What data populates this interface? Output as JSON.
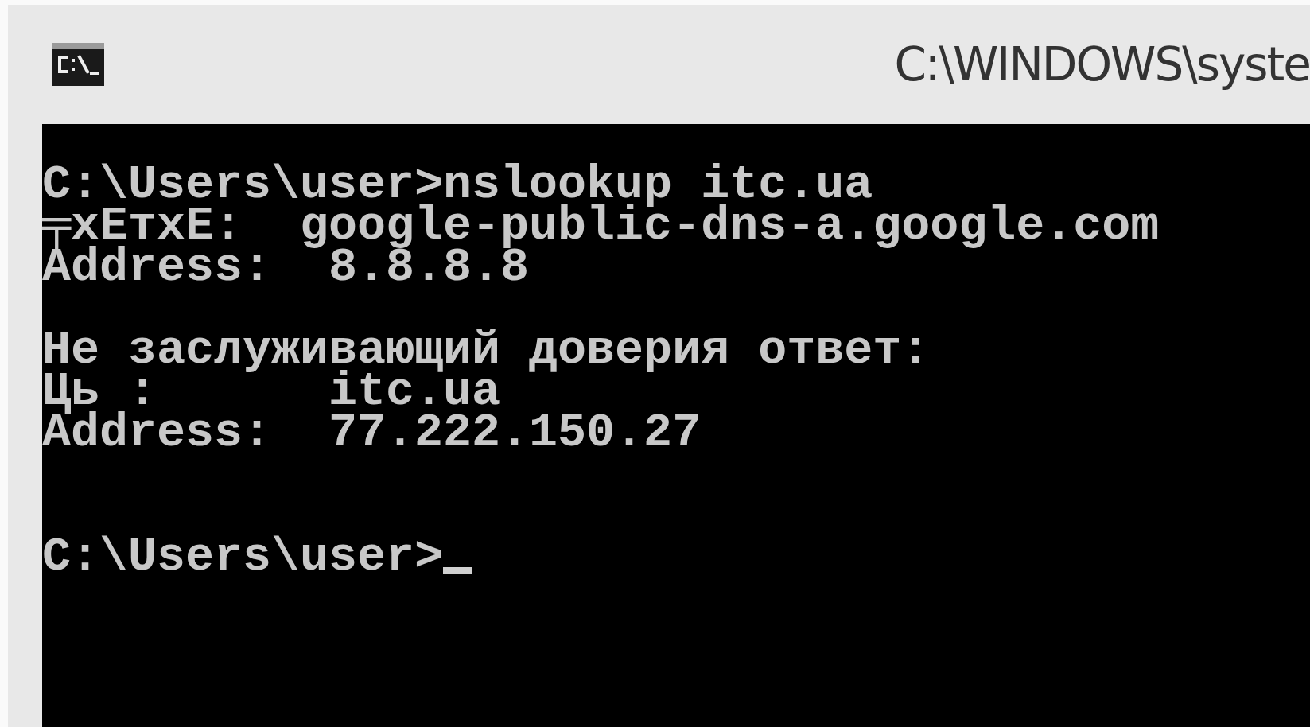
{
  "window": {
    "title": "C:\\WINDOWS\\syste"
  },
  "console": {
    "lines": [
      {
        "kind": "text",
        "text": "C:\\Users\\user>nslookup itc.ua",
        "cursor": false
      },
      {
        "kind": "text",
        "text": "╤xЕтxЕ:  google-public-dns-a.google.com",
        "cursor": false
      },
      {
        "kind": "text",
        "text": "Address:  8.8.8.8",
        "cursor": false
      },
      {
        "kind": "blank"
      },
      {
        "kind": "text",
        "text": "Не заслуживающий доверия ответ:",
        "cursor": false
      },
      {
        "kind": "text",
        "text": "Ць :      itc.ua",
        "cursor": false
      },
      {
        "kind": "text",
        "text": "Address:  77.222.150.27",
        "cursor": false
      },
      {
        "kind": "blank"
      },
      {
        "kind": "blank"
      },
      {
        "kind": "text",
        "text": "C:\\Users\\user>",
        "cursor": true
      }
    ]
  }
}
